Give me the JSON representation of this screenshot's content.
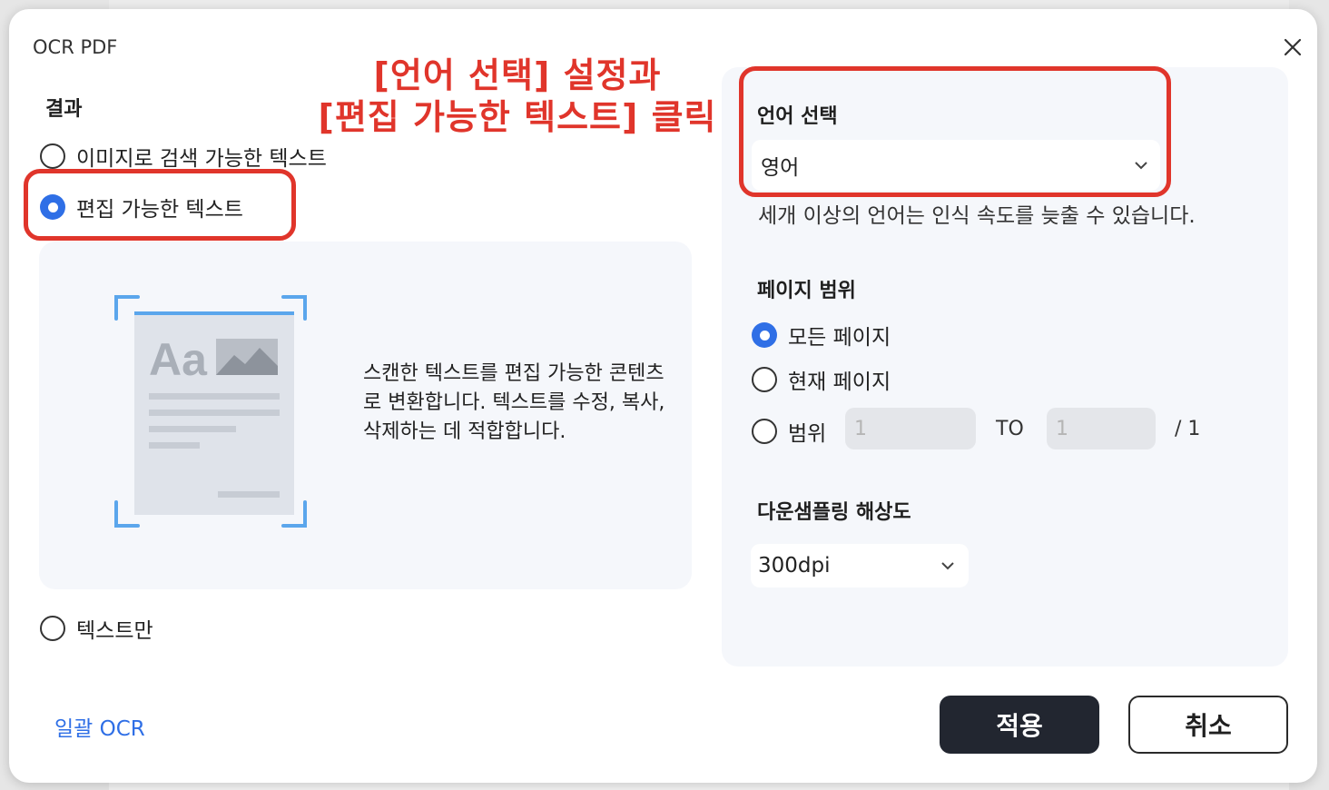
{
  "dialog": {
    "title": "OCR PDF",
    "annotation_line1": "[언어 선택] 설정과",
    "annotation_line2": "[편집 가능한 텍스트] 클릭"
  },
  "result": {
    "label": "결과",
    "options": [
      {
        "label": "이미지로 검색 가능한 텍스트",
        "checked": false
      },
      {
        "label": "편집 가능한 텍스트",
        "checked": true
      },
      {
        "label": "텍스트만",
        "checked": false
      }
    ],
    "preview_icon_text": "Aa",
    "description": "스캔한 텍스트를 편집 가능한 콘텐츠로 변환합니다. 텍스트를 수정, 복사, 삭제하는 데 적합합니다."
  },
  "language": {
    "label": "언어 선택",
    "selected": "영어",
    "hint": "세개 이상의 언어는 인식 속도를 늦출 수 있습니다."
  },
  "page_range": {
    "label": "페이지 범위",
    "options": [
      {
        "label": "모든 페이지",
        "checked": true
      },
      {
        "label": "현재 페이지",
        "checked": false
      },
      {
        "label": "범위",
        "checked": false
      }
    ],
    "from_value": "1",
    "to_label": "TO",
    "to_value": "1",
    "total": "/ 1"
  },
  "downsampling": {
    "label": "다운샘플링 해상도",
    "selected": "300dpi"
  },
  "footer": {
    "batch_ocr": "일괄 OCR",
    "apply": "적용",
    "cancel": "취소"
  },
  "colors": {
    "accent": "#2f6fe6",
    "highlight": "#e0352b",
    "primary_button": "#222630"
  }
}
